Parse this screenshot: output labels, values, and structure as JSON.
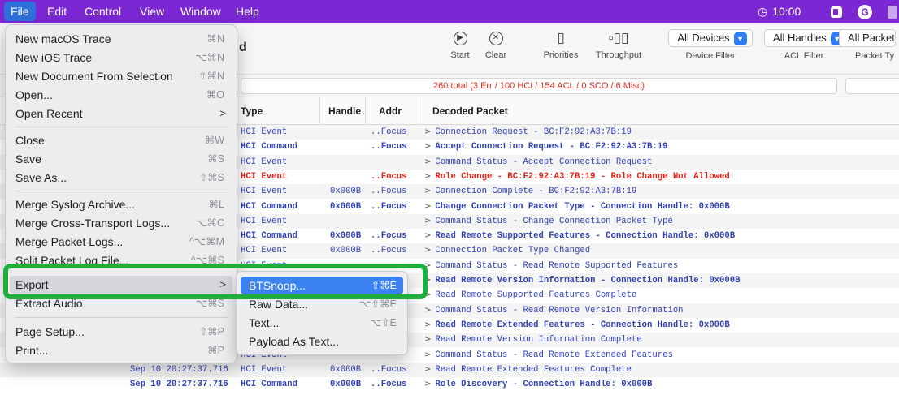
{
  "menubar": {
    "items": [
      "File",
      "Edit",
      "Control",
      "View",
      "Window",
      "Help"
    ],
    "clock": "10:00",
    "clock_icon": "timer-icon",
    "status_icons": [
      "app-square-icon",
      "grammarly-icon",
      "overflow-icon"
    ]
  },
  "toolbar": {
    "title_fragment": "d",
    "start_label": "Start",
    "clear_label": "Clear",
    "priorities_label": "Priorities",
    "throughput_label": "Throughput",
    "device_filter": {
      "value": "All Devices",
      "caption": "Device Filter"
    },
    "acl_filter": {
      "value": "All Handles",
      "caption": "ACL Filter"
    },
    "packet_filter": {
      "value": "All Packet",
      "caption": "Packet Ty"
    }
  },
  "totals": "260 total (3 Err / 100 HCI / 154 ACL / 0 SCO / 6 Misc)",
  "table": {
    "headers": {
      "type": "Type",
      "handle": "Handle",
      "addr": "Addr",
      "decoded": "Decoded Packet"
    },
    "rows": [
      {
        "time": "",
        "type": "HCI Event",
        "handle": "",
        "addr": "..Focus",
        "packet": "Connection Request - BC:F2:92:A3:7B:19",
        "style": "plain"
      },
      {
        "time": "",
        "type": "HCI Command",
        "handle": "",
        "addr": "..Focus",
        "packet": "Accept Connection Request - BC:F2:92:A3:7B:19",
        "style": "bold"
      },
      {
        "time": "",
        "type": "HCI Event",
        "handle": "",
        "addr": "",
        "packet": "Command Status - Accept Connection Request",
        "style": "plain"
      },
      {
        "time": "",
        "type": "HCI Event",
        "handle": "",
        "addr": "..Focus",
        "packet": "Role Change - BC:F2:92:A3:7B:19 - Role Change Not Allowed",
        "style": "err"
      },
      {
        "time": "",
        "type": "HCI Event",
        "handle": "0x000B",
        "addr": "..Focus",
        "packet": "Connection Complete - BC:F2:92:A3:7B:19",
        "style": "plain"
      },
      {
        "time": "",
        "type": "HCI Command",
        "handle": "0x000B",
        "addr": "..Focus",
        "packet": "Change Connection Packet Type - Connection Handle: 0x000B",
        "style": "bold"
      },
      {
        "time": "",
        "type": "HCI Event",
        "handle": "",
        "addr": "",
        "packet": "Command Status - Change Connection Packet Type",
        "style": "plain"
      },
      {
        "time": "",
        "type": "HCI Command",
        "handle": "0x000B",
        "addr": "..Focus",
        "packet": "Read Remote Supported Features - Connection Handle: 0x000B",
        "style": "bold"
      },
      {
        "time": "",
        "type": "HCI Event",
        "handle": "0x000B",
        "addr": "..Focus",
        "packet": "Connection Packet Type Changed",
        "style": "plain"
      },
      {
        "time": "",
        "type": "HCI Event",
        "handle": "",
        "addr": "",
        "packet": "Command Status - Read Remote Supported Features",
        "style": "plain"
      },
      {
        "time": "",
        "type": "",
        "handle": "",
        "addr": "",
        "packet": "Read Remote Version Information - Connection Handle: 0x000B",
        "style": "bold"
      },
      {
        "time": "",
        "type": "",
        "handle": "",
        "addr": "",
        "packet": "Read Remote Supported Features Complete",
        "style": "plain"
      },
      {
        "time": "",
        "type": "",
        "handle": "",
        "addr": "",
        "packet": "Command Status - Read Remote Version Information",
        "style": "plain"
      },
      {
        "time": "",
        "type": "",
        "handle": "",
        "addr": "",
        "packet": "Read Remote Extended Features - Connection Handle: 0x000B",
        "style": "bold"
      },
      {
        "time": "",
        "type": "",
        "handle": "",
        "addr": "",
        "packet": "Read Remote Version Information Complete",
        "style": "plain"
      },
      {
        "time": "",
        "type": "HCI Event",
        "handle": "",
        "addr": "",
        "packet": "Command Status - Read Remote Extended Features",
        "style": "plain"
      },
      {
        "time": "Sep 10 20:27:37.716",
        "type": "HCI Event",
        "handle": "0x000B",
        "addr": "..Focus",
        "packet": "Read Remote Extended Features Complete",
        "style": "plain"
      },
      {
        "time": "Sep 10 20:27:37.716",
        "type": "HCI Command",
        "handle": "0x000B",
        "addr": "..Focus",
        "packet": "Role Discovery - Connection Handle: 0x000B",
        "style": "bold"
      }
    ]
  },
  "file_menu": {
    "items": [
      {
        "label": "New macOS Trace",
        "shortcut": "⌘N"
      },
      {
        "label": "New iOS Trace",
        "shortcut": "⌥⌘N"
      },
      {
        "label": "New Document From Selection",
        "shortcut": "⇧⌘N"
      },
      {
        "label": "Open...",
        "shortcut": "⌘O"
      },
      {
        "label": "Open Recent",
        "shortcut": ""
      },
      {
        "label": "Close",
        "shortcut": "⌘W"
      },
      {
        "label": "Save",
        "shortcut": "⌘S"
      },
      {
        "label": "Save As...",
        "shortcut": "⇧⌘S"
      },
      {
        "label": "Merge Syslog Archive...",
        "shortcut": "⌘L"
      },
      {
        "label": "Merge Cross-Transport Logs...",
        "shortcut": "⌥⌘C"
      },
      {
        "label": "Merge Packet Logs...",
        "shortcut": "^⌥⌘M"
      },
      {
        "label": "Split Packet Log File...",
        "shortcut": "^⌥⌘S"
      },
      {
        "label": "Export",
        "shortcut": ""
      },
      {
        "label": "Extract Audio",
        "shortcut": "⌥⌘S"
      },
      {
        "label": "Page Setup...",
        "shortcut": "⇧⌘P"
      },
      {
        "label": "Print...",
        "shortcut": "⌘P"
      }
    ]
  },
  "export_submenu": {
    "items": [
      {
        "label": "BTSnoop...",
        "shortcut": "⇧⌘E"
      },
      {
        "label": "Raw Data...",
        "shortcut": "⌥⇧⌘E"
      },
      {
        "label": "Text...",
        "shortcut": "⌥⇧E"
      },
      {
        "label": "Payload As Text...",
        "shortcut": ""
      }
    ]
  },
  "colors": {
    "menubar": "#7b27d3",
    "selection": "#3b82f0",
    "highlight_frame": "#1fae3e",
    "packet_text": "#2f3fb8",
    "error_text": "#e52319"
  }
}
